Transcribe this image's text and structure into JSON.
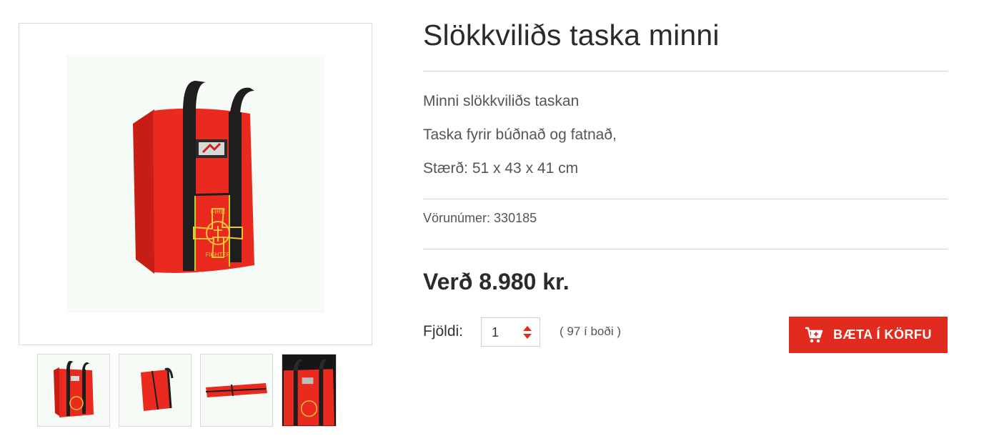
{
  "product": {
    "title": "Slökkviliðs taska minni",
    "description": [
      "Minni slökkviliðs  taskan",
      "Taska fyrir búðnað og fatnað,",
      "Stærð: 51 x 43 x 41 cm"
    ],
    "sku_text": "Vörunúmer: 330185",
    "price_text": "Verð 8.980 kr.",
    "quantity_label": "Fjöldi:",
    "quantity_value": "1",
    "stock_text": "( 97 í boði )",
    "add_to_cart_label": "BÆTA Í KÖRFU"
  },
  "badge": {
    "line1": "FIRE",
    "line2": "FIGHTER"
  },
  "colors": {
    "accent": "#e02b1e",
    "bag_red": "#e8261c",
    "strap": "#1e1e1e",
    "emblem": "#f2c23a"
  },
  "gallery": {
    "thumbnail_count": 4
  }
}
